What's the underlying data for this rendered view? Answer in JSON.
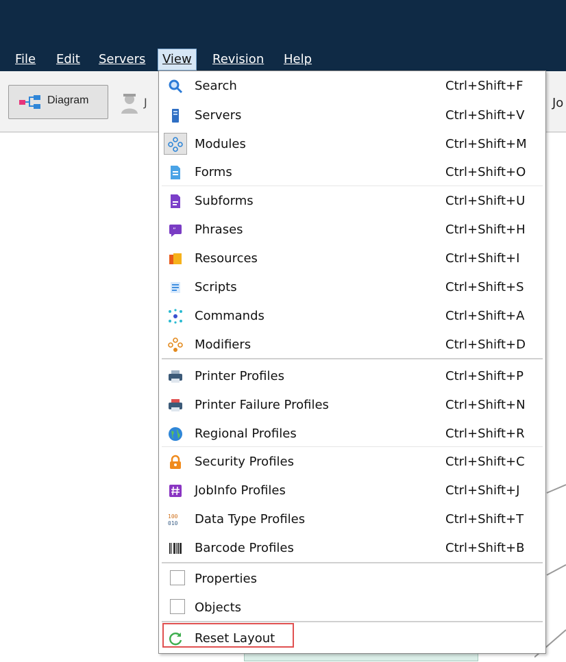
{
  "menubar": {
    "items": [
      {
        "label": "File",
        "accel": "F"
      },
      {
        "label": "Edit",
        "accel": "E"
      },
      {
        "label": "Servers",
        "accel": "S"
      },
      {
        "label": "View",
        "accel": "V"
      },
      {
        "label": "Revision",
        "accel": "R"
      },
      {
        "label": "Help",
        "accel": "H"
      }
    ]
  },
  "toolbar": {
    "diagram_label": "Diagram",
    "partial_left": "J",
    "partial_right": "Jo"
  },
  "view_menu": {
    "items": [
      {
        "label": "Search",
        "shortcut": "Ctrl+Shift+F",
        "icon": "search-icon"
      },
      {
        "label": "Servers",
        "shortcut": "Ctrl+Shift+V",
        "icon": "server-icon"
      },
      {
        "label": "Modules",
        "shortcut": "Ctrl+Shift+M",
        "icon": "modules-icon"
      },
      {
        "label": "Forms",
        "shortcut": "Ctrl+Shift+O",
        "icon": "form-icon"
      },
      {
        "label": "Subforms",
        "shortcut": "Ctrl+Shift+U",
        "icon": "subform-icon"
      },
      {
        "label": "Phrases",
        "shortcut": "Ctrl+Shift+H",
        "icon": "phrase-icon"
      },
      {
        "label": "Resources",
        "shortcut": "Ctrl+Shift+I",
        "icon": "resources-icon"
      },
      {
        "label": "Scripts",
        "shortcut": "Ctrl+Shift+S",
        "icon": "script-icon"
      },
      {
        "label": "Commands",
        "shortcut": "Ctrl+Shift+A",
        "icon": "commands-icon"
      },
      {
        "label": "Modifiers",
        "shortcut": "Ctrl+Shift+D",
        "icon": "modifiers-icon"
      },
      {
        "label": "Printer Profiles",
        "shortcut": "Ctrl+Shift+P",
        "icon": "printer-icon"
      },
      {
        "label": "Printer Failure Profiles",
        "shortcut": "Ctrl+Shift+N",
        "icon": "printer-failure-icon"
      },
      {
        "label": "Regional Profiles",
        "shortcut": "Ctrl+Shift+R",
        "icon": "globe-icon"
      },
      {
        "label": "Security Profiles",
        "shortcut": "Ctrl+Shift+C",
        "icon": "lock-icon"
      },
      {
        "label": "JobInfo Profiles",
        "shortcut": "Ctrl+Shift+J",
        "icon": "hash-icon"
      },
      {
        "label": "Data Type Profiles",
        "shortcut": "Ctrl+Shift+T",
        "icon": "binary-icon"
      },
      {
        "label": "Barcode Profiles",
        "shortcut": "Ctrl+Shift+B",
        "icon": "barcode-icon"
      },
      {
        "label": "Properties",
        "shortcut": "",
        "icon": "checkbox"
      },
      {
        "label": "Objects",
        "shortcut": "",
        "icon": "checkbox"
      },
      {
        "label": "Reset Layout",
        "shortcut": "",
        "icon": "refresh-icon"
      }
    ]
  },
  "colors": {
    "titlebar": "#0f2a45",
    "highlight_border": "#e05050"
  }
}
